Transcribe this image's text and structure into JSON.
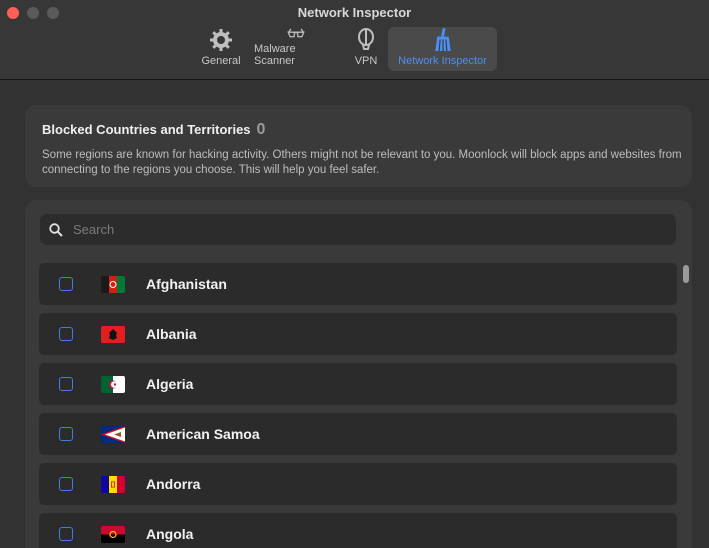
{
  "window": {
    "title": "Network Inspector"
  },
  "toolbar": {
    "tabs": [
      {
        "label": "General",
        "icon": "gear-icon"
      },
      {
        "label": "Malware Scanner",
        "icon": "glasses-icon"
      },
      {
        "label": "VPN",
        "icon": "balloon-icon"
      },
      {
        "label": "Network Inspector",
        "icon": "broom-icon",
        "active": true
      }
    ]
  },
  "blocked": {
    "title": "Blocked Countries and Territories",
    "count": "0",
    "description": "Some regions are known for hacking activity. Others might not be relevant to you. Moonlock will block apps and websites from connecting to the regions you choose. This will help you feel safer."
  },
  "search": {
    "placeholder": "Search",
    "value": ""
  },
  "countries": [
    {
      "name": "Afghanistan",
      "checked": false,
      "flag": "afghanistan-flag-icon"
    },
    {
      "name": "Albania",
      "checked": false,
      "flag": "albania-flag-icon"
    },
    {
      "name": "Algeria",
      "checked": false,
      "flag": "algeria-flag-icon"
    },
    {
      "name": "American Samoa",
      "checked": false,
      "flag": "american-samoa-flag-icon"
    },
    {
      "name": "Andorra",
      "checked": false,
      "flag": "andorra-flag-icon"
    },
    {
      "name": "Angola",
      "checked": false,
      "flag": "angola-flag-icon"
    }
  ],
  "colors": {
    "accent": "#4d8ef5",
    "close": "#fe5f57",
    "background": "#323232"
  }
}
